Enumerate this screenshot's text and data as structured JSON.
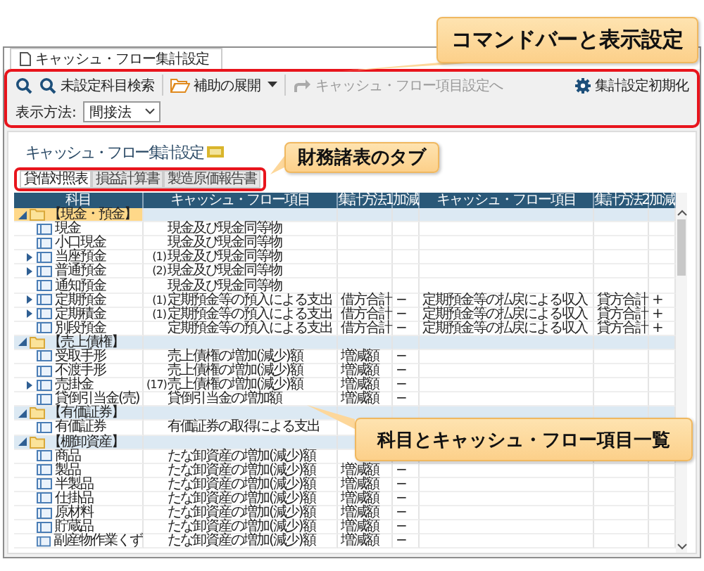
{
  "window": {
    "tab_title": "キャッシュ・フロー集計設定"
  },
  "toolbar": {
    "search_label": "未設定科目検索",
    "expand_label": "補助の展開",
    "goto_label": "キャッシュ・フロー項目設定へ",
    "goto_disabled": true,
    "reset_label": "集計設定初期化"
  },
  "display": {
    "label": "表示方法:",
    "value": "間接法"
  },
  "page_title": "キャッシュ・フロー集計設定",
  "tabs": [
    {
      "label": "貸借対照表",
      "selected": true
    },
    {
      "label": "損益計算書",
      "selected": false
    },
    {
      "label": "製造原価報告書",
      "selected": false
    }
  ],
  "table": {
    "columns": [
      "科目",
      "キャッシュ・フロー項目",
      "集計方法1",
      "加減",
      "キャッシュ・フロー項目",
      "集計方法2",
      "加減"
    ],
    "groups": [
      {
        "label": "【現金・預金】",
        "expanded": true,
        "selected": true,
        "children": [
          {
            "label": "現金",
            "has_children": false,
            "selected": false,
            "cf_item": "現金及び現金同等物"
          },
          {
            "label": "小口現金",
            "has_children": false,
            "selected": false,
            "cf_item": "現金及び現金同等物"
          },
          {
            "label": "当座預金",
            "has_children": true,
            "selected": false,
            "prefix": "(1)",
            "cf_item": "現金及び現金同等物"
          },
          {
            "label": "普通預金",
            "has_children": true,
            "selected": false,
            "prefix": "(2)",
            "cf_item": "現金及び現金同等物"
          },
          {
            "label": "通知預金",
            "has_children": false,
            "selected": false,
            "cf_item": "現金及び現金同等物"
          },
          {
            "label": "定期預金",
            "has_children": true,
            "selected": false,
            "prefix": "(1)",
            "cf_item": "定期預金等の預入による支出",
            "method1": "借方合計",
            "sign1": "−",
            "cf_item2": "定期預金等の払戻による収入",
            "method2": "貸方合計",
            "sign2": "+"
          },
          {
            "label": "定期積金",
            "has_children": true,
            "selected": false,
            "prefix": "(1)",
            "cf_item": "定期預金等の預入による支出",
            "method1": "借方合計",
            "sign1": "−",
            "cf_item2": "定期預金等の払戻による収入",
            "method2": "貸方合計",
            "sign2": "+"
          },
          {
            "label": "別段預金",
            "has_children": false,
            "selected": false,
            "cf_item": "定期預金等の預入による支出",
            "method1": "借方合計",
            "sign1": "−",
            "cf_item2": "定期預金等の払戻による収入",
            "method2": "貸方合計",
            "sign2": "+"
          }
        ]
      },
      {
        "label": "【売上債権】",
        "expanded": true,
        "selected": false,
        "children": [
          {
            "label": "受取手形",
            "has_children": false,
            "selected": false,
            "cf_item": "売上債権の増加(減少)額",
            "method1": "増減額",
            "sign1": "−"
          },
          {
            "label": "不渡手形",
            "has_children": false,
            "selected": false,
            "cf_item": "売上債権の増加(減少)額",
            "method1": "増減額",
            "sign1": "−"
          },
          {
            "label": "売掛金",
            "has_children": true,
            "selected": false,
            "prefix": "(17)",
            "cf_item": "売上債権の増加(減少)額",
            "method1": "増減額",
            "sign1": "−"
          },
          {
            "label": "貸倒引当金(売)",
            "has_children": false,
            "selected": false,
            "cf_item": "貸倒引当金の増加額",
            "method1": "増減額",
            "sign1": "−"
          }
        ]
      },
      {
        "label": "【有価証券】",
        "expanded": true,
        "selected": false,
        "children": [
          {
            "label": "有価証券",
            "has_children": false,
            "selected": false,
            "cf_item": "有価証券の取得による支出"
          }
        ]
      },
      {
        "label": "【棚卸資産】",
        "expanded": true,
        "selected": false,
        "children": [
          {
            "label": "商品",
            "has_children": false,
            "selected": false,
            "cf_item": "たな卸資産の増加(減少)額"
          },
          {
            "label": "製品",
            "has_children": false,
            "selected": false,
            "cf_item": "たな卸資産の増加(減少)額",
            "method1": "増減額",
            "sign1": "−"
          },
          {
            "label": "半製品",
            "has_children": false,
            "selected": false,
            "cf_item": "たな卸資産の増加(減少)額",
            "method1": "増減額",
            "sign1": "−"
          },
          {
            "label": "仕掛品",
            "has_children": false,
            "selected": false,
            "cf_item": "たな卸資産の増加(減少)額",
            "method1": "増減額",
            "sign1": "−"
          },
          {
            "label": "原材料",
            "has_children": false,
            "selected": false,
            "cf_item": "たな卸資産の増加(減少)額",
            "method1": "増減額",
            "sign1": "−"
          },
          {
            "label": "貯蔵品",
            "has_children": false,
            "selected": false,
            "cf_item": "たな卸資産の増加(減少)額",
            "method1": "増減額",
            "sign1": "−"
          },
          {
            "label": "副産物作業くず",
            "has_children": false,
            "selected": false,
            "cf_item": "たな卸資産の増加(減少)額",
            "method1": "増減額",
            "sign1": "−"
          }
        ]
      }
    ]
  },
  "callouts": [
    {
      "text": "コマンドバーと表示設定"
    },
    {
      "text": "財務諸表のタブ"
    },
    {
      "text": "科目とキャッシュ・フロー項目一覧"
    }
  ]
}
